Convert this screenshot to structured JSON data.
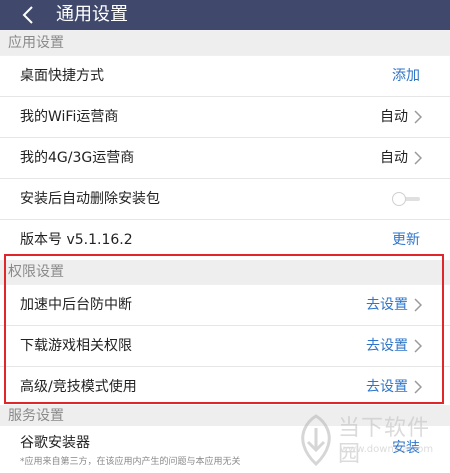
{
  "header": {
    "title": "通用设置",
    "back_icon": "chevron-left-icon"
  },
  "sections": {
    "app": "应用设置",
    "permission": "权限设置",
    "service": "服务设置"
  },
  "app_settings": {
    "shortcut": {
      "label": "桌面快捷方式",
      "action": "添加"
    },
    "wifi": {
      "label": "我的WiFi运营商",
      "value": "自动"
    },
    "mobile": {
      "label": "我的4G/3G运营商",
      "value": "自动"
    },
    "auto_delete": {
      "label": "安装后自动删除安装包",
      "enabled": false
    },
    "version": {
      "label": "版本号 v5.1.16.2",
      "action": "更新"
    }
  },
  "permission_settings": [
    {
      "label": "加速中后台防中断",
      "action": "去设置"
    },
    {
      "label": "下载游戏相关权限",
      "action": "去设置"
    },
    {
      "label": "高级/竞技模式使用",
      "action": "去设置"
    }
  ],
  "service_settings": {
    "google": {
      "label": "谷歌安装器",
      "note": "*应用来自第三方，在该应用内产生的问题与本应用无关",
      "action": "安装"
    }
  },
  "watermark": {
    "name": "当下软件园",
    "url": "www.downxia.com"
  },
  "colors": {
    "header": "#40496c",
    "link": "#2f75c9",
    "highlight": "#e0262b"
  }
}
